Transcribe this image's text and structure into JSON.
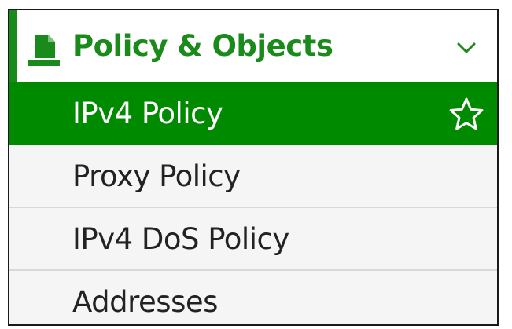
{
  "section": {
    "title": "Policy & Objects",
    "icon": "policy-document-icon",
    "expand_icon": "chevron-down-icon"
  },
  "menu": {
    "items": [
      {
        "label": "IPv4 Policy",
        "active": true,
        "favorite_icon": "star-outline-icon"
      },
      {
        "label": "Proxy Policy",
        "active": false
      },
      {
        "label": "IPv4 DoS Policy",
        "active": false
      },
      {
        "label": "Addresses",
        "active": false
      }
    ]
  },
  "colors": {
    "accent": "#1a8a1a",
    "active_background": "#008a00",
    "active_text": "#ffffff",
    "text": "#222222"
  }
}
